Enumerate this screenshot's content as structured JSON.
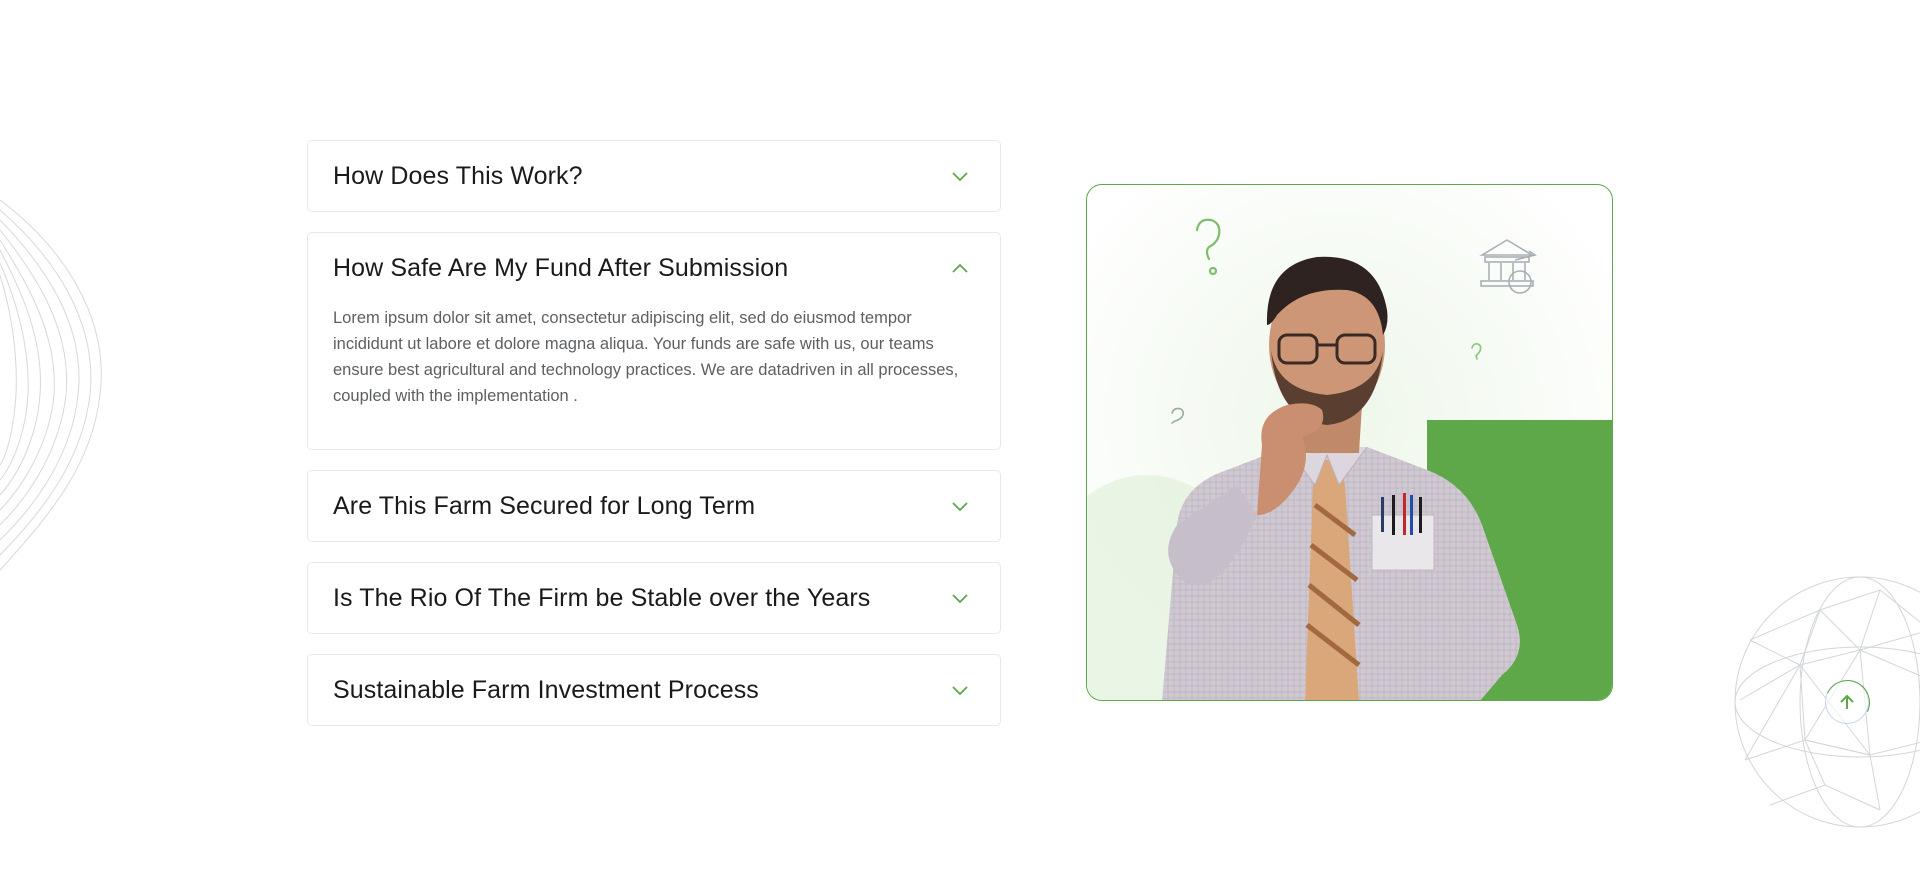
{
  "faq": {
    "items": [
      {
        "question": "How Does This Work?",
        "open": false
      },
      {
        "question": "How Safe Are My Fund After Submission",
        "open": true,
        "answer": "Lorem ipsum dolor sit amet, consectetur adipiscing elit, sed do eiusmod tempor incididunt ut labore et dolore magna aliqua. Your funds are safe with us, our teams ensure best agricultural and technology practices. We are datadriven in all processes, coupled with the implementation ."
      },
      {
        "question": "Are This Farm Secured for Long Term",
        "open": false
      },
      {
        "question": "Is The Rio Of The Firm be Stable over the Years",
        "open": false
      },
      {
        "question": "Sustainable Farm Investment Process",
        "open": false
      }
    ]
  },
  "icons": {
    "collapsed": "chevron-down-icon",
    "expanded": "chevron-up-icon",
    "scroll_top": "arrow-up-icon",
    "card_decorations": [
      "question-mark-icon",
      "bank-coin-icon"
    ]
  },
  "colors": {
    "accent": "#5ea84a",
    "border": "#e6e8ea",
    "question_text": "#1a1a1a",
    "answer_text": "#5c5f62"
  }
}
